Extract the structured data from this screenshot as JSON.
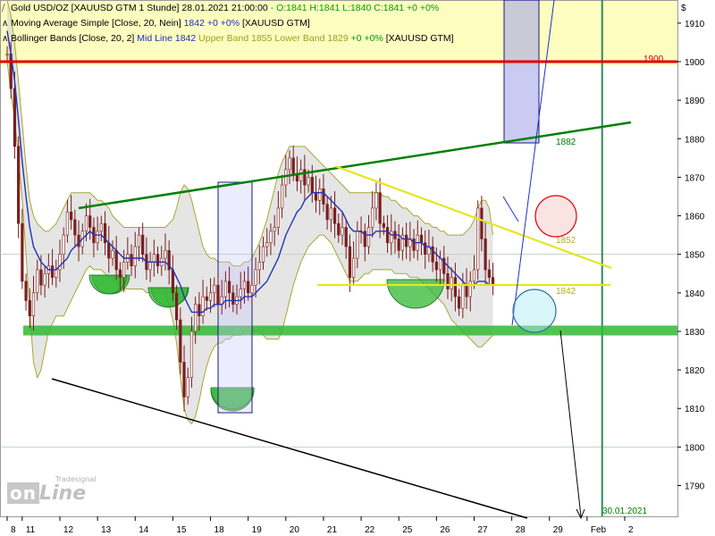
{
  "legend": {
    "row1_name": "Gold USD/OZ [XAUUSD GTM  1 Stunde] 28.01.2021 21:00:00",
    "row1_ohlc": "- O:1841 H:1841 L:1840 C:1841 +0 +0%",
    "row2_name": "Moving Average Simple [Close, 20, Nein]",
    "row2_val": "1842 +0 +0%",
    "row2_sym": "[XAUUSD GTM]",
    "row3_name": "Bollinger Bands [Close, 20, 2]",
    "row3_mid": "Mid Line 1842",
    "row3_band": "Upper Band 1855 Lower Band 1829",
    "row3_val": "+0 +0%",
    "row3_sym": "[XAUUSD GTM]"
  },
  "currency_symbol": "$",
  "labels": {
    "level_1900": "1900",
    "level_1882": "1882",
    "level_1852": "1852",
    "level_1842": "1842",
    "date_marker": "30.01.2021"
  },
  "logo": {
    "on": "on",
    "line": "Line",
    "tradesignal": "Tradesignal"
  },
  "colors": {
    "price": "#7a1e1e",
    "ma": "#2433b5",
    "band": "#a8a830",
    "band_fill": "#cfcfcf",
    "resistance_red": "#e00000",
    "support_green": "#32b832",
    "trend_green": "#008000",
    "yellow": "#e6e620",
    "highlight_yellow": "#fdfdc0"
  },
  "chart_data": {
    "type": "line",
    "title": "Gold USD/OZ [XAUUSD GTM  1 Stunde]",
    "ylim": [
      1782,
      1916
    ],
    "y_ticks": [
      1790,
      1800,
      1810,
      1820,
      1830,
      1840,
      1850,
      1860,
      1870,
      1880,
      1890,
      1900,
      1910
    ],
    "x_ticks": [
      {
        "label": "8",
        "i": 0
      },
      {
        "label": "11",
        "i": 4
      },
      {
        "label": "12",
        "i": 14
      },
      {
        "label": "13",
        "i": 24
      },
      {
        "label": "14",
        "i": 34
      },
      {
        "label": "15",
        "i": 44
      },
      {
        "label": "18",
        "i": 54
      },
      {
        "label": "19",
        "i": 64
      },
      {
        "label": "20",
        "i": 74
      },
      {
        "label": "21",
        "i": 84
      },
      {
        "label": "22",
        "i": 94
      },
      {
        "label": "25",
        "i": 104
      },
      {
        "label": "26",
        "i": 114
      },
      {
        "label": "27",
        "i": 124
      },
      {
        "label": "28",
        "i": 134
      },
      {
        "label": "29",
        "i": 144
      },
      {
        "label": "Feb",
        "i": 154
      },
      {
        "label": "2",
        "i": 164
      }
    ],
    "x_max": 178,
    "series": [
      {
        "name": "Gold USD/OZ",
        "values": [
          1902,
          1893,
          1878,
          1858,
          1843,
          1838,
          1834,
          1840,
          1846,
          1842,
          1845,
          1847,
          1844,
          1846,
          1850,
          1855,
          1861,
          1859,
          1855,
          1852,
          1856,
          1860,
          1857,
          1853,
          1856,
          1858,
          1853,
          1849,
          1851,
          1846,
          1844,
          1848,
          1850,
          1847,
          1852,
          1855,
          1850,
          1846,
          1848,
          1850,
          1847,
          1849,
          1851,
          1846,
          1840,
          1833,
          1822,
          1813,
          1818,
          1830,
          1837,
          1834,
          1839,
          1838,
          1840,
          1842,
          1837,
          1839,
          1843,
          1840,
          1837,
          1839,
          1841,
          1843,
          1840,
          1842,
          1846,
          1848,
          1852,
          1853,
          1856,
          1857,
          1862,
          1868,
          1872,
          1875,
          1871,
          1869,
          1872,
          1868,
          1870,
          1866,
          1864,
          1867,
          1863,
          1859,
          1862,
          1858,
          1855,
          1857,
          1852,
          1844,
          1849,
          1856,
          1856,
          1852,
          1857,
          1862,
          1866,
          1858,
          1857,
          1853,
          1856,
          1854,
          1851,
          1855,
          1852,
          1854,
          1851,
          1855,
          1853,
          1850,
          1852,
          1848,
          1846,
          1849,
          1845,
          1841,
          1844,
          1839,
          1836,
          1842,
          1839,
          1843,
          1846,
          1862,
          1854,
          1846,
          1844,
          1842
        ]
      },
      {
        "name": "Moving Average Simple",
        "values": [
          1908,
          1902,
          1895,
          1885,
          1874,
          1865,
          1857,
          1852,
          1850,
          1848,
          1847,
          1846,
          1846,
          1846,
          1847,
          1848,
          1849,
          1851,
          1852,
          1853,
          1854,
          1855,
          1856,
          1855,
          1855,
          1855,
          1854,
          1853,
          1852,
          1851,
          1850,
          1849,
          1849,
          1849,
          1849,
          1849,
          1849,
          1848,
          1848,
          1848,
          1848,
          1848,
          1848,
          1847,
          1846,
          1844,
          1842,
          1839,
          1837,
          1835,
          1835,
          1835,
          1835,
          1836,
          1836,
          1837,
          1837,
          1837,
          1838,
          1838,
          1838,
          1838,
          1838,
          1839,
          1839,
          1839,
          1840,
          1841,
          1842,
          1843,
          1845,
          1847,
          1849,
          1852,
          1855,
          1857,
          1859,
          1861,
          1862,
          1864,
          1865,
          1866,
          1866,
          1866,
          1866,
          1865,
          1864,
          1863,
          1862,
          1861,
          1859,
          1857,
          1856,
          1856,
          1856,
          1855,
          1855,
          1855,
          1856,
          1856,
          1856,
          1856,
          1855,
          1855,
          1855,
          1854,
          1854,
          1854,
          1853,
          1853,
          1853,
          1852,
          1852,
          1851,
          1850,
          1849,
          1848,
          1847,
          1846,
          1845,
          1844,
          1843,
          1842,
          1842,
          1842,
          1843,
          1843,
          1843,
          1842,
          1842
        ]
      }
    ],
    "bollinger_upper_approx": [
      1916,
      1912,
      1905,
      1895,
      1884,
      1873,
      1864,
      1860,
      1858,
      1857,
      1856,
      1856,
      1857,
      1858,
      1860,
      1862,
      1864,
      1866,
      1866,
      1866,
      1866,
      1866,
      1866,
      1865,
      1864,
      1864,
      1863,
      1862,
      1860,
      1859,
      1858,
      1857,
      1857,
      1857,
      1857,
      1857,
      1857,
      1857,
      1857,
      1857,
      1857,
      1857,
      1857,
      1858,
      1859,
      1862,
      1866,
      1868,
      1867,
      1864,
      1860,
      1856,
      1852,
      1850,
      1849,
      1849,
      1848,
      1848,
      1848,
      1848,
      1847,
      1847,
      1847,
      1848,
      1848,
      1849,
      1851,
      1853,
      1856,
      1859,
      1863,
      1867,
      1871,
      1874,
      1876,
      1878,
      1878,
      1878,
      1878,
      1878,
      1877,
      1876,
      1875,
      1874,
      1873,
      1872,
      1871,
      1870,
      1869,
      1868,
      1867,
      1866,
      1866,
      1866,
      1866,
      1866,
      1866,
      1866,
      1866,
      1866,
      1865,
      1865,
      1864,
      1864,
      1863,
      1862,
      1862,
      1861,
      1860,
      1860,
      1859,
      1858,
      1858,
      1857,
      1857,
      1856,
      1856,
      1855,
      1855,
      1855,
      1855,
      1855,
      1856,
      1857,
      1859,
      1862,
      1864,
      1864,
      1862,
      1855
    ],
    "bollinger_lower_approx": [
      1900,
      1892,
      1885,
      1875,
      1864,
      1850,
      1835,
      1822,
      1818,
      1820,
      1825,
      1830,
      1832,
      1834,
      1834,
      1834,
      1836,
      1838,
      1840,
      1842,
      1844,
      1846,
      1847,
      1846,
      1846,
      1846,
      1845,
      1844,
      1844,
      1843,
      1842,
      1841,
      1841,
      1841,
      1841,
      1841,
      1841,
      1840,
      1840,
      1840,
      1840,
      1840,
      1840,
      1837,
      1833,
      1827,
      1818,
      1810,
      1807,
      1806,
      1808,
      1812,
      1817,
      1821,
      1824,
      1826,
      1827,
      1827,
      1828,
      1828,
      1829,
      1829,
      1829,
      1830,
      1830,
      1830,
      1830,
      1830,
      1829,
      1828,
      1828,
      1828,
      1828,
      1830,
      1834,
      1838,
      1842,
      1845,
      1848,
      1850,
      1852,
      1853,
      1854,
      1855,
      1855,
      1854,
      1853,
      1851,
      1849,
      1847,
      1845,
      1843,
      1843,
      1843,
      1844,
      1845,
      1845,
      1846,
      1846,
      1846,
      1846,
      1846,
      1846,
      1845,
      1845,
      1845,
      1845,
      1844,
      1844,
      1844,
      1843,
      1842,
      1841,
      1840,
      1839,
      1838,
      1837,
      1835,
      1833,
      1832,
      1831,
      1830,
      1829,
      1828,
      1827,
      1826,
      1826,
      1827,
      1828,
      1829
    ],
    "annotations": [
      {
        "name": "resistance 1900",
        "y": 1900
      },
      {
        "name": "support zone",
        "y": 1830
      },
      {
        "name": "horizontal 1842",
        "y": 1842
      }
    ]
  }
}
